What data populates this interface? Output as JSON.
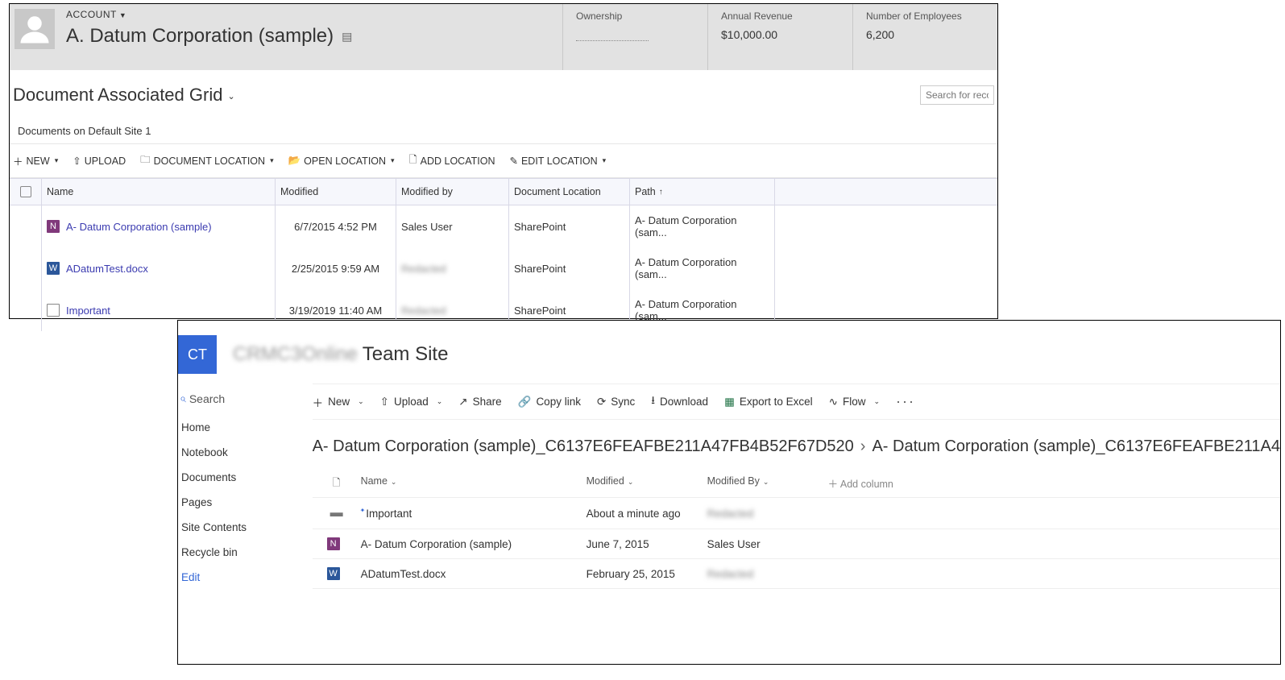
{
  "crm": {
    "entityLabel": "ACCOUNT",
    "entityName": "A. Datum Corporation (sample)",
    "stats": {
      "ownershipLabel": "Ownership",
      "revenueLabel": "Annual Revenue",
      "revenueValue": "$10,000.00",
      "employeesLabel": "Number of Employees",
      "employeesValue": "6,200"
    },
    "gridTitle": "Document Associated Grid",
    "searchPlaceholder": "Search for reco",
    "siteLabel": "Documents on Default Site 1",
    "toolbar": {
      "new": "NEW",
      "upload": "UPLOAD",
      "docLoc": "DOCUMENT LOCATION",
      "openLoc": "OPEN LOCATION",
      "addLoc": "ADD LOCATION",
      "editLoc": "EDIT LOCATION"
    },
    "columns": {
      "name": "Name",
      "modified": "Modified",
      "modifiedBy": "Modified by",
      "docLocation": "Document Location",
      "path": "Path"
    },
    "rows": [
      {
        "icon": "onenote",
        "name": "A- Datum Corporation (sample)",
        "modified": "6/7/2015 4:52 PM",
        "modifiedBy": "Sales User",
        "modifiedByBlur": false,
        "location": "SharePoint",
        "path": "A- Datum Corporation (sam..."
      },
      {
        "icon": "word",
        "name": "ADatumTest.docx",
        "modified": "2/25/2015 9:59 AM",
        "modifiedBy": "Redacted",
        "modifiedByBlur": true,
        "location": "SharePoint",
        "path": "A- Datum Corporation (sam..."
      },
      {
        "icon": "unknown",
        "name": "Important",
        "modified": "3/19/2019 11:40 AM",
        "modifiedBy": "Redacted",
        "modifiedByBlur": true,
        "location": "SharePoint",
        "path": "A- Datum Corporation (sam..."
      }
    ]
  },
  "sp": {
    "logoText": "CT",
    "siteNameBlur": "CRMC3Online",
    "siteName": "Team Site",
    "search": "Search",
    "nav": [
      "Home",
      "Notebook",
      "Documents",
      "Pages",
      "Site Contents",
      "Recycle bin"
    ],
    "edit": "Edit",
    "toolbar": {
      "new": "New",
      "upload": "Upload",
      "share": "Share",
      "copyLink": "Copy link",
      "sync": "Sync",
      "download": "Download",
      "exportExcel": "Export to Excel",
      "flow": "Flow"
    },
    "breadcrumb": {
      "part1": "A- Datum Corporation (sample)_C6137E6FEAFBE211A47FB4B52F67D520",
      "part2": "A- Datum Corporation (sample)_C6137E6FEAFBE211A4"
    },
    "columns": {
      "name": "Name",
      "modified": "Modified",
      "modifiedBy": "Modified By",
      "addColumn": "Add column"
    },
    "rows": [
      {
        "icon": "folder",
        "corner": true,
        "name": "Important",
        "modified": "About a minute ago",
        "modifiedBy": "Redacted",
        "modifiedByBlur": true
      },
      {
        "icon": "onenote",
        "corner": false,
        "name": "A- Datum Corporation (sample)",
        "modified": "June 7, 2015",
        "modifiedBy": "Sales User",
        "modifiedByBlur": false
      },
      {
        "icon": "word",
        "corner": false,
        "name": "ADatumTest.docx",
        "modified": "February 25, 2015",
        "modifiedBy": "Redacted",
        "modifiedByBlur": true
      }
    ]
  }
}
